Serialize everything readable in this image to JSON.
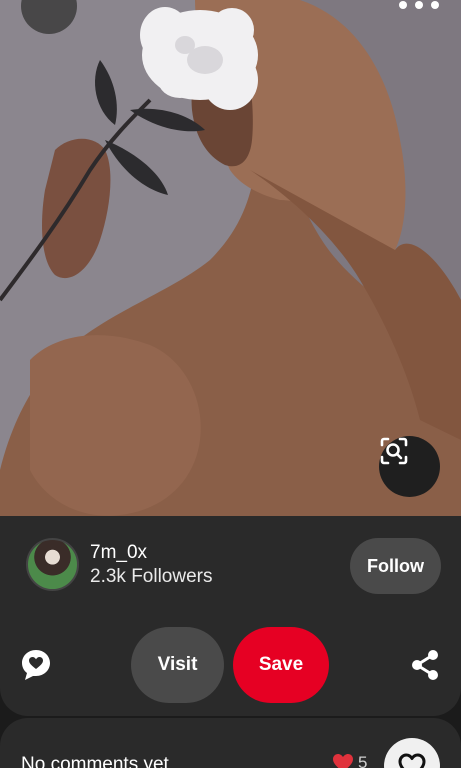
{
  "pin": {
    "image_description_icon": "photo",
    "lens_icon": "visual-search-icon"
  },
  "top_bar": {
    "back_icon": "chevron-left-icon",
    "more_icon": "ellipsis-icon"
  },
  "creator": {
    "name": "7m_0x",
    "followers": "2.3k Followers",
    "follow_label": "Follow"
  },
  "actions": {
    "comment_icon": "comment-icon",
    "visit_label": "Visit",
    "save_label": "Save",
    "share_icon": "share-icon"
  },
  "comments": {
    "empty_text": "No comments yet",
    "like_count": "5",
    "reaction_icon": "heart-icon"
  },
  "colors": {
    "save": "#e60023",
    "panel": "#2a2a2a",
    "pill": "#4a4a4a"
  }
}
